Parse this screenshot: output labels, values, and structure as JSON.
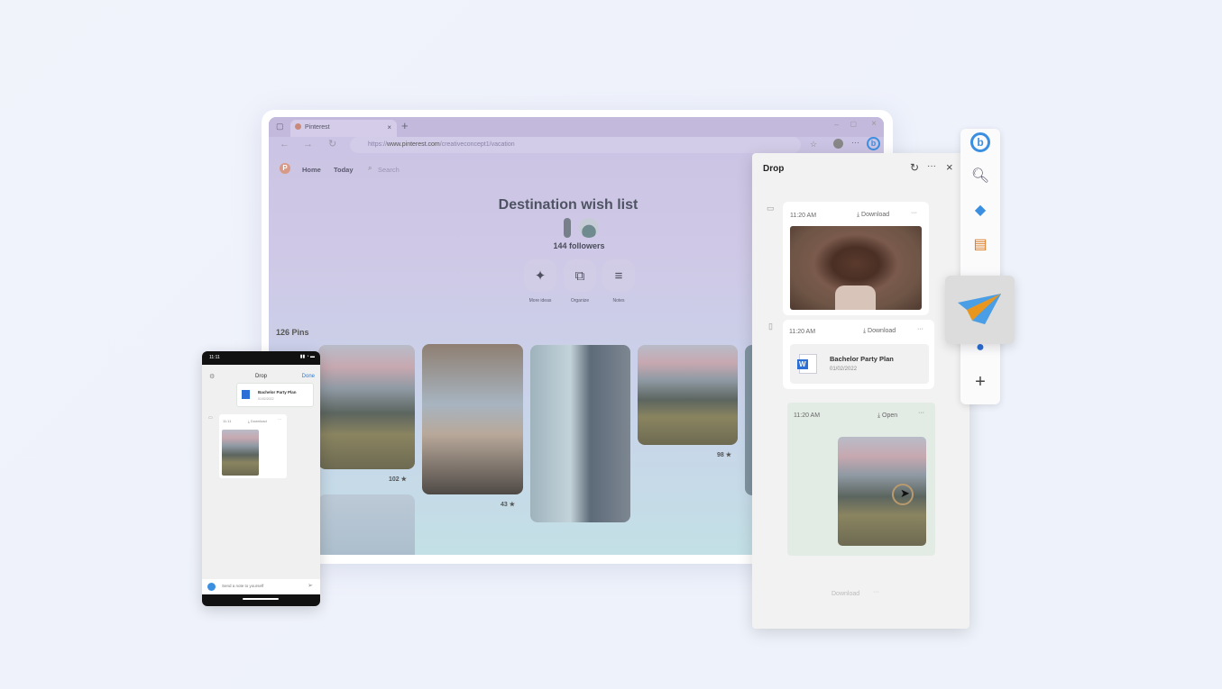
{
  "browser": {
    "tab_title": "Pinterest",
    "url_prefix": "https://",
    "url_domain": "www.pinterest.com",
    "url_path": "/creativeconcept1/vacation",
    "nav": {
      "home": "Home",
      "today": "Today",
      "search_placeholder": "Search"
    }
  },
  "board": {
    "title": "Destination wish list",
    "followers": "144 followers",
    "actions": [
      {
        "label": "More ideas",
        "icon": "sparkle-icon"
      },
      {
        "label": "Organize",
        "icon": "organize-icon"
      },
      {
        "label": "Notes",
        "icon": "notes-icon"
      }
    ],
    "pins_count": "126 Pins",
    "pin_counts": [
      "102",
      "43",
      "98"
    ]
  },
  "drop": {
    "title": "Drop",
    "items": [
      {
        "time": "11:20 AM",
        "action": "Download",
        "type": "image",
        "source": "desktop"
      },
      {
        "time": "11:20 AM",
        "action": "Download",
        "type": "file",
        "file_name": "Bachelor Party Plan",
        "file_date": "01/02/2022",
        "source": "phone"
      },
      {
        "time": "11:20 AM",
        "action": "Open",
        "type": "image"
      }
    ],
    "footer_action": "Download"
  },
  "sidebar": {
    "icons": [
      "bing-icon",
      "search-icon",
      "tag-icon",
      "toolbox-icon",
      "drop-icon",
      "outlook-icon",
      "add-icon"
    ],
    "accent": "#3b8fe0"
  },
  "phone": {
    "status_time": "11:11",
    "title": "Drop",
    "done": "Done",
    "file_name": "Bachelor Party Plan",
    "file_date": "01/02/2022",
    "item_time": "11:11",
    "item_action": "Download",
    "input_placeholder": "Send a note to yourself"
  }
}
